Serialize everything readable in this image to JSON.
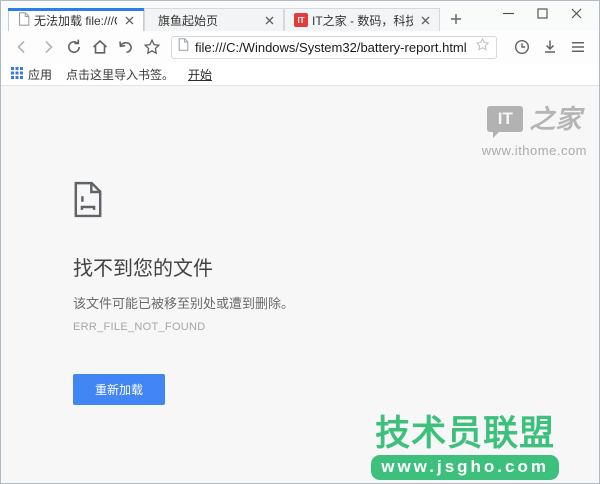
{
  "tabs": [
    {
      "title": "无法加载 file:///C:/Windo",
      "active": true
    },
    {
      "title": "旗鱼起始页",
      "active": false
    },
    {
      "title": "IT之家 - 数码，科技，生",
      "favicon_text": "IT",
      "active": false
    }
  ],
  "toolbar": {
    "url": "file:///C:/Windows/System32/battery-report.html"
  },
  "bookmarks_bar": {
    "apps_label": "应用",
    "import_hint": "点击这里导入书签。",
    "start_link": "开始"
  },
  "error_page": {
    "title": "找不到您的文件",
    "description": "该文件可能已被移至别处或遭到删除。",
    "error_code": "ERR_FILE_NOT_FOUND",
    "reload_button": "重新加载"
  },
  "watermarks": {
    "ithome": {
      "logo": "IT",
      "suffix": "之家",
      "url": "www.ithome.com"
    },
    "jsgho": {
      "title": "技术员联盟",
      "url": "www.jsgho.com"
    }
  },
  "colors": {
    "accent": "#2b7de9",
    "button_blue": "#4285f4",
    "watermark_green": "#3ec07d",
    "favicon_red": "#e23c3c"
  }
}
